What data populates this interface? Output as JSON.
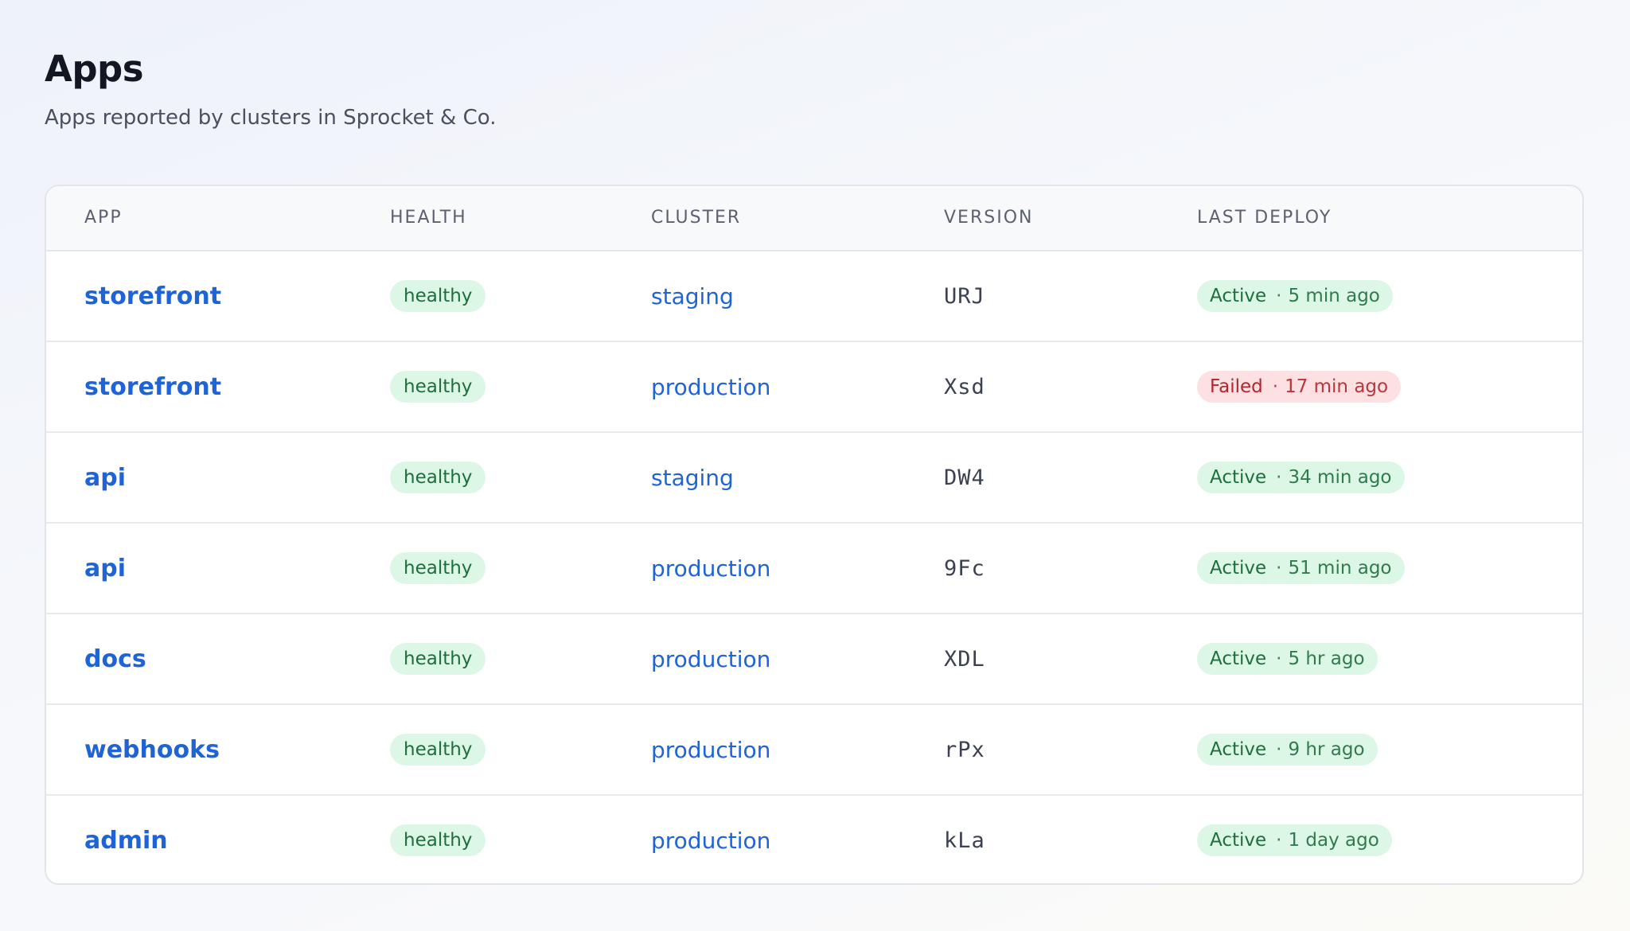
{
  "header": {
    "title": "Apps",
    "subtitle": "Apps reported by clusters in Sprocket & Co."
  },
  "table": {
    "columns": [
      "APP",
      "HEALTH",
      "CLUSTER",
      "VERSION",
      "LAST DEPLOY"
    ],
    "separator": "·",
    "rows": [
      {
        "app": "storefront",
        "health": "healthy",
        "cluster": "staging",
        "version": "URJ",
        "deploy_status": "Active",
        "deploy_time": "5 min ago",
        "deploy_state": "active"
      },
      {
        "app": "storefront",
        "health": "healthy",
        "cluster": "production",
        "version": "Xsd",
        "deploy_status": "Failed",
        "deploy_time": "17 min ago",
        "deploy_state": "failed"
      },
      {
        "app": "api",
        "health": "healthy",
        "cluster": "staging",
        "version": "DW4",
        "deploy_status": "Active",
        "deploy_time": "34 min ago",
        "deploy_state": "active"
      },
      {
        "app": "api",
        "health": "healthy",
        "cluster": "production",
        "version": "9Fc",
        "deploy_status": "Active",
        "deploy_time": "51 min ago",
        "deploy_state": "active"
      },
      {
        "app": "docs",
        "health": "healthy",
        "cluster": "production",
        "version": "XDL",
        "deploy_status": "Active",
        "deploy_time": "5 hr ago",
        "deploy_state": "active"
      },
      {
        "app": "webhooks",
        "health": "healthy",
        "cluster": "production",
        "version": "rPx",
        "deploy_status": "Active",
        "deploy_time": "9 hr ago",
        "deploy_state": "active"
      },
      {
        "app": "admin",
        "health": "healthy",
        "cluster": "production",
        "version": "kLa",
        "deploy_status": "Active",
        "deploy_time": "1 day ago",
        "deploy_state": "active"
      }
    ]
  },
  "colors": {
    "link": "#1f64d6",
    "healthy_bg": "#dcf7e5",
    "healthy_text": "#1e6e3e",
    "failed_bg": "#fde0e2",
    "failed_text": "#b1252e"
  }
}
